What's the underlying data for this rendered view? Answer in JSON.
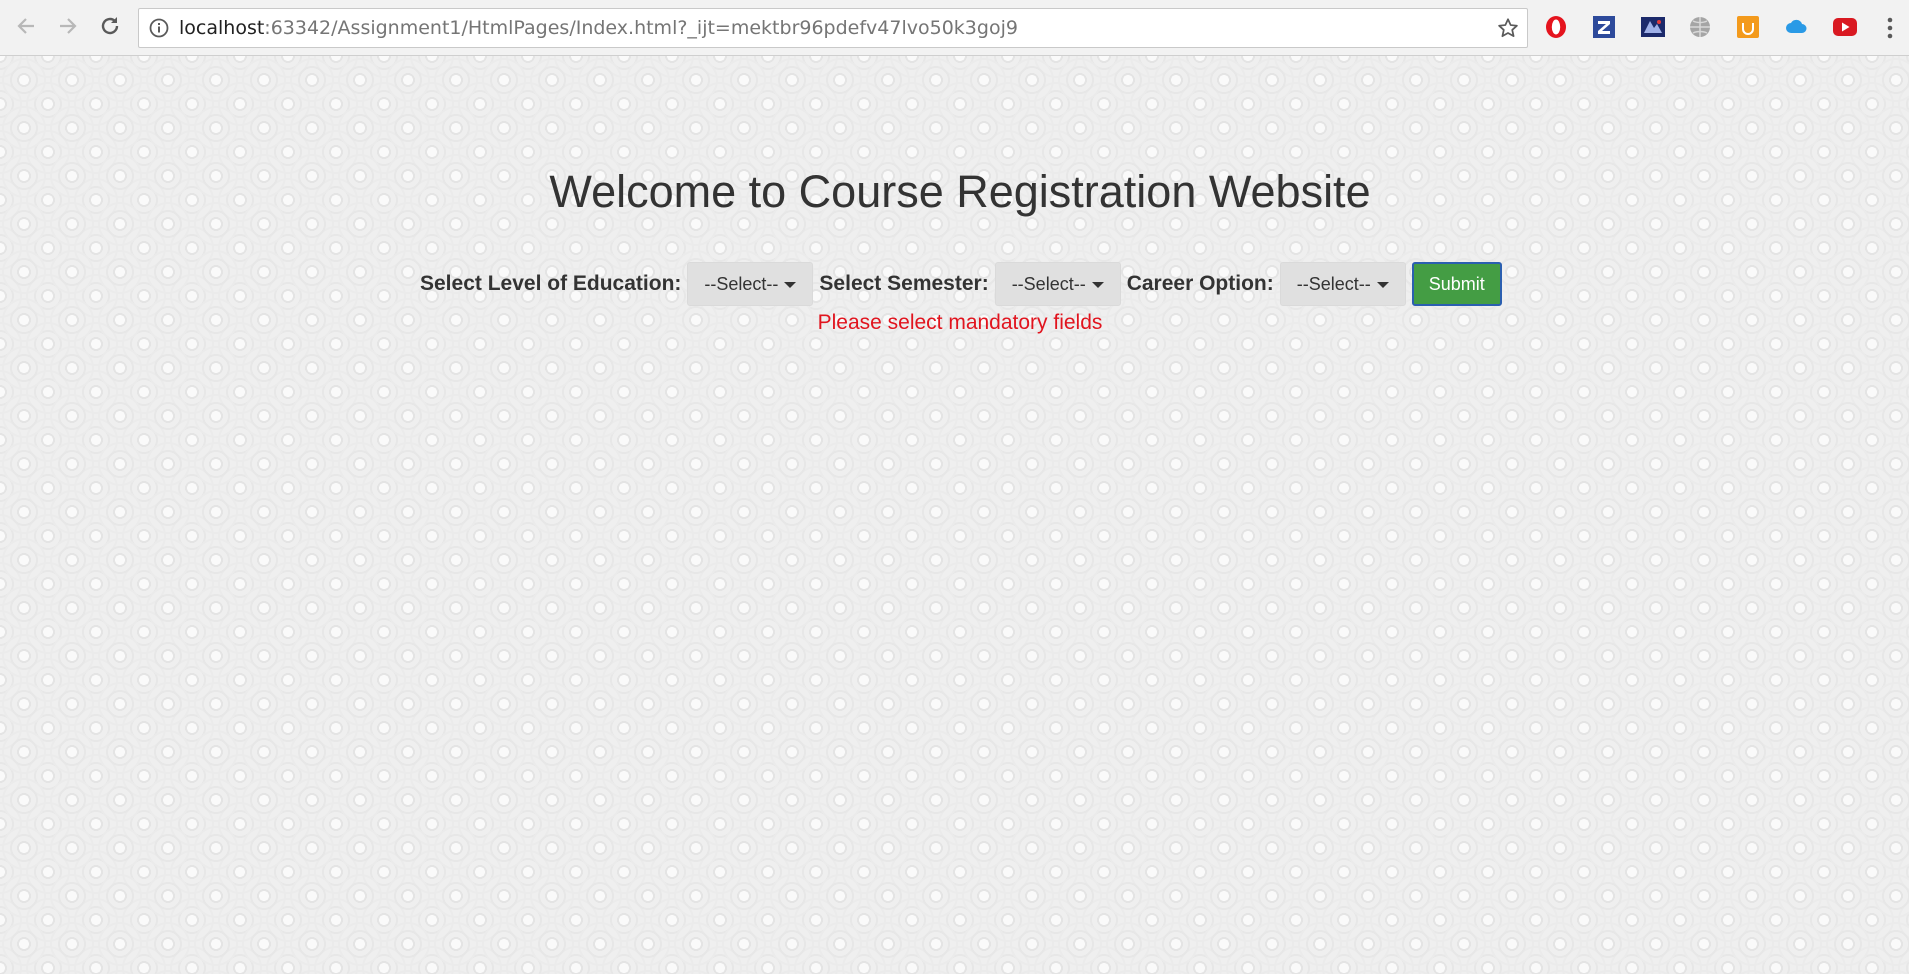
{
  "browser": {
    "url_host": "localhost",
    "url_rest": ":63342/Assignment1/HtmlPages/Index.html?_ijt=mektbr96pdefv47lvo50k3goj9",
    "extensions": [
      "opera-icon",
      "zotero-icon",
      "extension-icon",
      "globe-icon",
      "honey-icon",
      "cloud-icon",
      "youtube-icon"
    ]
  },
  "page": {
    "heading": "Welcome to Course Registration Website",
    "form": {
      "education_label": "Select Level of Education:",
      "education_value": "--Select--",
      "semester_label": "Select Semester:",
      "semester_value": "--Select--",
      "career_label": "Career Option:",
      "career_value": "--Select--",
      "submit_label": "Submit"
    },
    "error_message": "Please select mandatory fields"
  },
  "colors": {
    "submit_bg": "#449d44",
    "error_text": "#e1141e",
    "heading_text": "#333333"
  }
}
